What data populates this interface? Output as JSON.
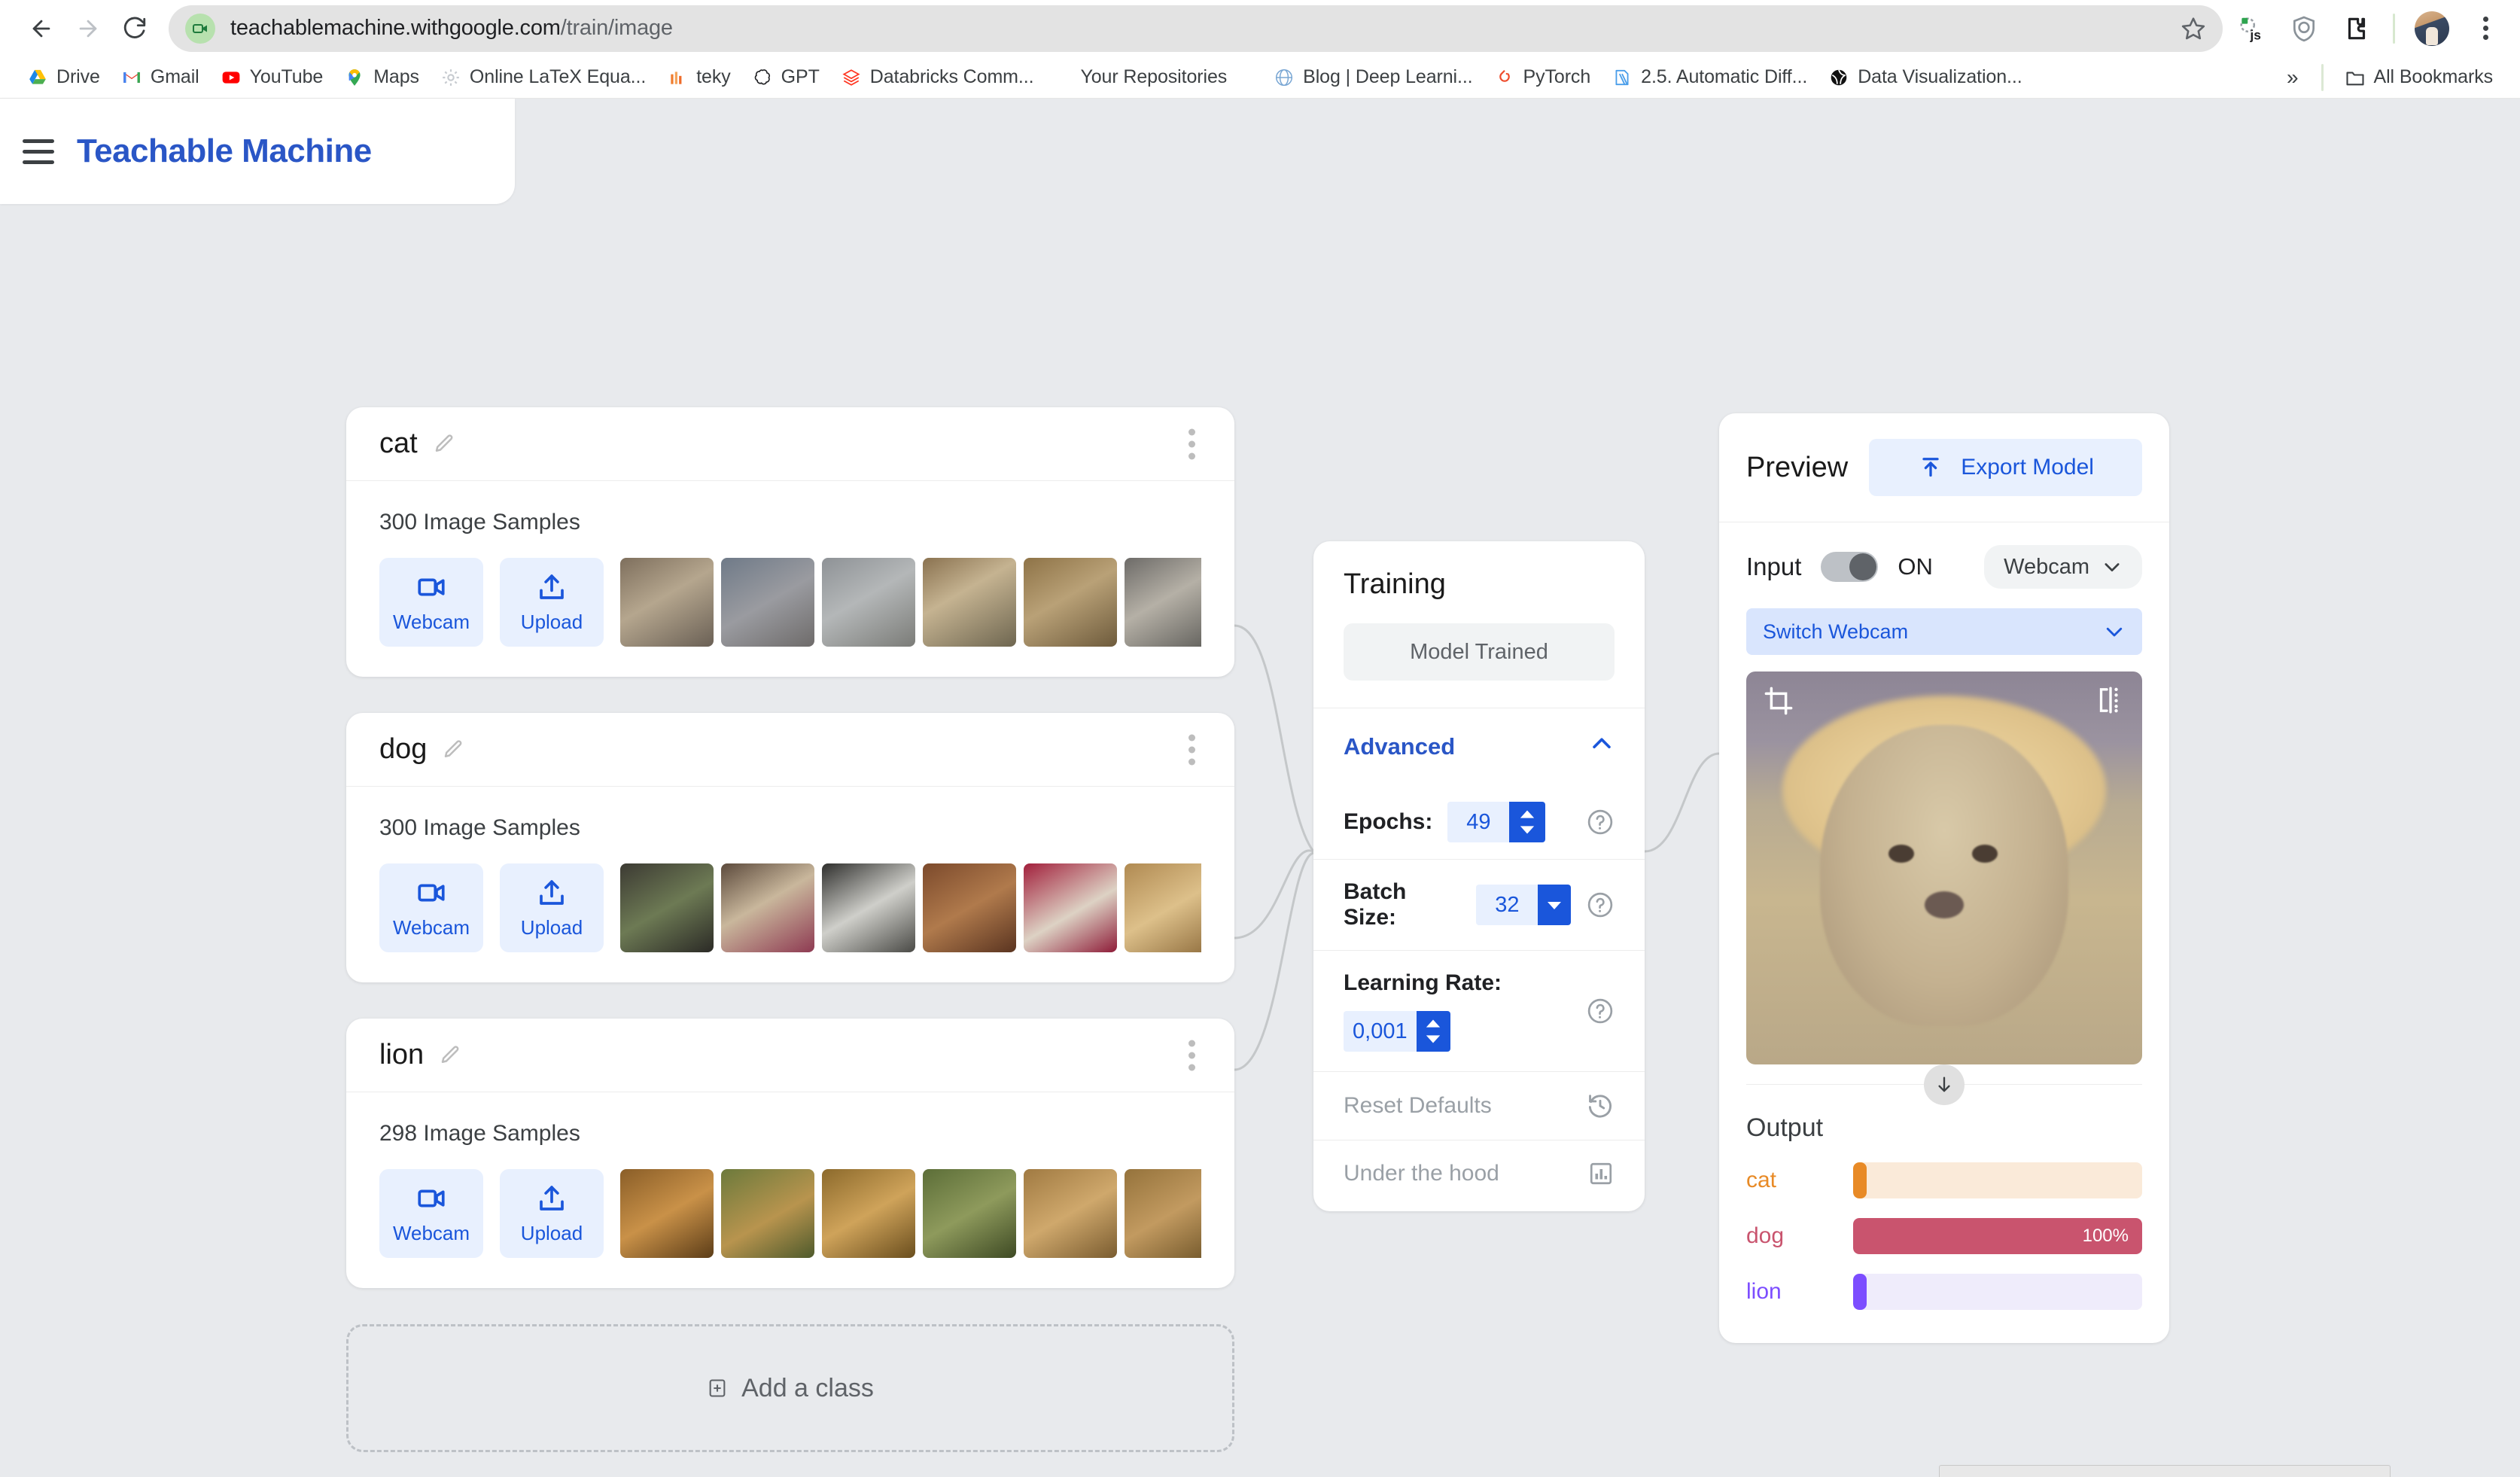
{
  "browser": {
    "url_domain": "teachablemachine.withgoogle.com",
    "url_path": "/train/image",
    "back_icon": "back-arrow-icon",
    "forward_icon": "forward-arrow-icon",
    "reload_icon": "reload-icon",
    "site_icon": "video-camera-icon",
    "bookmark_star_icon": "star-icon",
    "bookmarks": [
      {
        "label": "Drive",
        "icon": "google-drive-icon"
      },
      {
        "label": "Gmail",
        "icon": "gmail-icon"
      },
      {
        "label": "YouTube",
        "icon": "youtube-icon"
      },
      {
        "label": "Maps",
        "icon": "google-maps-icon"
      },
      {
        "label": "Online LaTeX Equa...",
        "icon": "gear-icon"
      },
      {
        "label": "teky",
        "icon": "teky-icon"
      },
      {
        "label": "GPT",
        "icon": "openai-icon"
      },
      {
        "label": "Databricks Comm...",
        "icon": "databricks-icon"
      },
      {
        "label": "Your Repositories",
        "icon": "none"
      },
      {
        "label": "Blog | Deep Learni...",
        "icon": "globe-icon"
      },
      {
        "label": "PyTorch",
        "icon": "pytorch-icon"
      },
      {
        "label": "2.5. Automatic Diff...",
        "icon": "book-icon"
      },
      {
        "label": "Data Visualization...",
        "icon": "sphere-icon"
      }
    ],
    "overflow_label": "»",
    "all_bookmarks_label": "All Bookmarks",
    "all_bookmarks_icon": "folder-icon",
    "extensions": [
      {
        "name": "javascript-extension-icon"
      },
      {
        "name": "shield-extension-icon"
      },
      {
        "name": "puzzle-extension-icon"
      }
    ],
    "profile_icon": "avatar",
    "menu_icon": "vertical-kebab-icon"
  },
  "app": {
    "title": "Teachable Machine",
    "menu_icon": "hamburger-icon"
  },
  "classes": [
    {
      "name": "cat",
      "samples_label": "300 Image Samples",
      "webcam_label": "Webcam",
      "upload_label": "Upload",
      "thumb_colors": [
        "#9b8c78",
        "#8c8a90",
        "#9b9fa2",
        "#ae9a7f",
        "#a08f6f",
        "#8f8c85",
        "#c89a60"
      ]
    },
    {
      "name": "dog",
      "samples_label": "300 Image Samples",
      "webcam_label": "Webcam",
      "upload_label": "Upload",
      "thumb_colors": [
        "#4a4238",
        "#9d7f5e",
        "#5b5b57",
        "#8b5a3c",
        "#c8bca8",
        "#c9a264",
        "#bf9a5e"
      ]
    },
    {
      "name": "lion",
      "samples_label": "298 Image Samples",
      "webcam_label": "Webcam",
      "upload_label": "Upload",
      "thumb_colors": [
        "#a4763a",
        "#7c6236",
        "#9d7a3e",
        "#6d7a42",
        "#b08b52",
        "#a07a44",
        "#b0a08a"
      ]
    }
  ],
  "add_class": {
    "label": "Add a class",
    "icon": "add-box-icon"
  },
  "training": {
    "title": "Training",
    "train_button_label": "Model Trained",
    "advanced_label": "Advanced",
    "advanced_chevron": "chevron-up-icon",
    "epochs_label": "Epochs:",
    "epochs_value": "49",
    "batch_size_label": "Batch Size:",
    "batch_size_value": "32",
    "learning_rate_label": "Learning Rate:",
    "learning_rate_value": "0,001",
    "reset_defaults_label": "Reset Defaults",
    "reset_defaults_icon": "history-icon",
    "under_the_hood_label": "Under the hood",
    "under_the_hood_icon": "bar-chart-icon",
    "help_icon": "help-circle-icon"
  },
  "preview": {
    "title": "Preview",
    "export_label": "Export Model",
    "export_icon": "upload-icon",
    "input_label": "Input",
    "toggle_state": "ON",
    "source_value": "Webcam",
    "source_chevron": "chevron-down-icon",
    "switch_webcam_label": "Switch Webcam",
    "switch_webcam_chevron": "chevron-down-icon",
    "crop_icon": "crop-icon",
    "flip_icon": "flip-icon",
    "scroll_icon": "arrow-down-icon",
    "output_title": "Output",
    "predictions": [
      {
        "label": "cat",
        "percent": 0,
        "percent_text": "",
        "color": "#e88a26",
        "track": "#faead9"
      },
      {
        "label": "dog",
        "percent": 100,
        "percent_text": "100%",
        "color": "#c9546e",
        "track": "#c9546e"
      },
      {
        "label": "lion",
        "percent": 0,
        "percent_text": "",
        "color": "#7c4dff",
        "track": "#efecfb"
      }
    ]
  },
  "colors": {
    "brand_blue": "#2a56c6",
    "accent_blue": "#1a56db",
    "light_blue": "#e8f0fe",
    "page_bg": "#e8eaed"
  }
}
